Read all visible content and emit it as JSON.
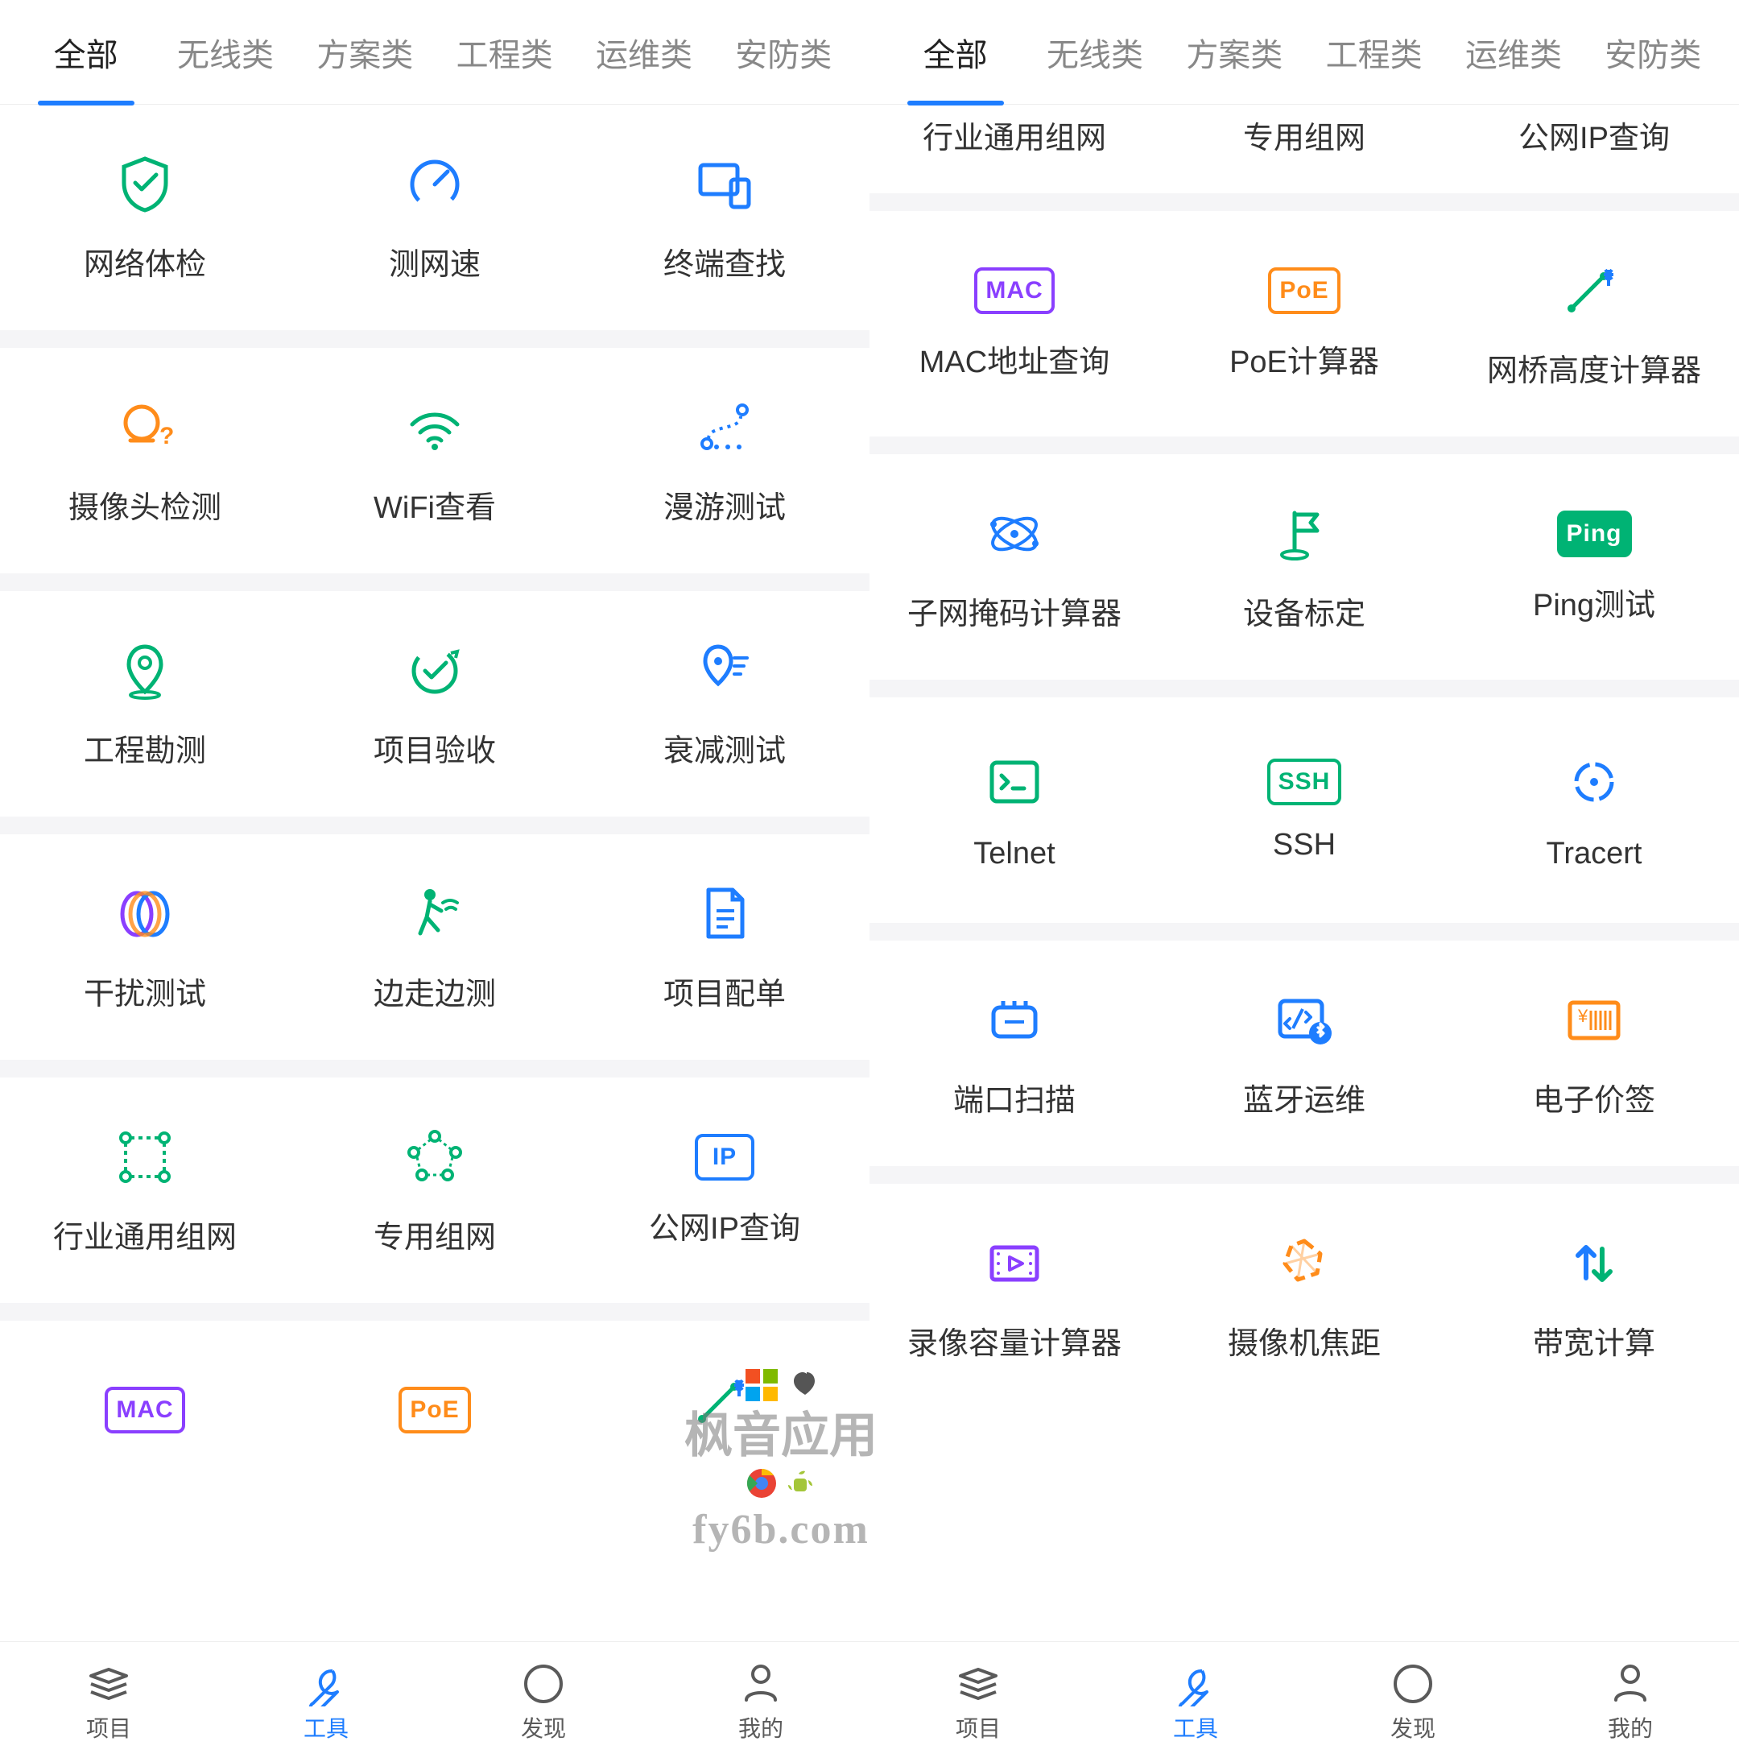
{
  "tabs": [
    "全部",
    "无线类",
    "方案类",
    "工程类",
    "运维类",
    "安防类"
  ],
  "activeTab": "全部",
  "screenLeft": {
    "groups": [
      {
        "tools": [
          {
            "id": "net-check",
            "label": "网络体检",
            "color": "#00b374",
            "svg": "shield-check"
          },
          {
            "id": "speed-test",
            "label": "测网速",
            "color": "#1e7dff",
            "svg": "gauge"
          },
          {
            "id": "terminal-find",
            "label": "终端查找",
            "color": "#1e7dff",
            "svg": "devices"
          }
        ]
      },
      {
        "tools": [
          {
            "id": "camera-detect",
            "label": "摄像头检测",
            "color": "#ff8c1a",
            "svg": "camera-q"
          },
          {
            "id": "wifi-view",
            "label": "WiFi查看",
            "color": "#00b374",
            "svg": "wifi"
          },
          {
            "id": "roam-test",
            "label": "漫游测试",
            "color": "#1e7dff",
            "svg": "route"
          }
        ]
      },
      {
        "tools": [
          {
            "id": "survey",
            "label": "工程勘测",
            "color": "#00b374",
            "svg": "pin-person"
          },
          {
            "id": "accept",
            "label": "项目验收",
            "color": "#00b374",
            "svg": "check-circle-arrow"
          },
          {
            "id": "atten",
            "label": "衰减测试",
            "color": "#1e7dff",
            "svg": "pin-waves"
          }
        ]
      },
      {
        "tools": [
          {
            "id": "interf",
            "label": "干扰测试",
            "color": "#8a3fff",
            "svg": "interf"
          },
          {
            "id": "walk-test",
            "label": "边走边测",
            "color": "#00b374",
            "svg": "walk-wifi"
          },
          {
            "id": "bom",
            "label": "项目配单",
            "color": "#1e7dff",
            "svg": "doc"
          }
        ]
      },
      {
        "tools": [
          {
            "id": "topo",
            "label": "行业通用组网",
            "color": "#00b374",
            "svg": "topo-square"
          },
          {
            "id": "topo2",
            "label": "专用组网",
            "color": "#00b374",
            "svg": "topo-ring"
          },
          {
            "id": "ip",
            "label": "公网IP查询",
            "badge": "IP",
            "badgeClass": "ip"
          }
        ]
      }
    ],
    "partial": [
      {
        "id": "mac",
        "badge": "MAC",
        "badgeClass": "mac"
      },
      {
        "id": "poe",
        "badge": "PoE",
        "badgeClass": "poe"
      },
      {
        "id": "bridge",
        "color": "#00b374",
        "svg": "bridge"
      }
    ]
  },
  "screenRight": {
    "topLabels": [
      "行业通用组网",
      "专用组网",
      "公网IP查询"
    ],
    "groups": [
      {
        "tools": [
          {
            "id": "mac",
            "label": "MAC地址查询",
            "badge": "MAC",
            "badgeClass": "mac"
          },
          {
            "id": "poe",
            "label": "PoE计算器",
            "badge": "PoE",
            "badgeClass": "poe"
          },
          {
            "id": "bridge",
            "label": "网桥高度计算器",
            "color": "#00b374",
            "svg": "bridge"
          }
        ]
      },
      {
        "tools": [
          {
            "id": "subnet",
            "label": "子网掩码计算器",
            "color": "#1e7dff",
            "svg": "atom"
          },
          {
            "id": "calib",
            "label": "设备标定",
            "color": "#00b374",
            "svg": "flag"
          },
          {
            "id": "ping",
            "label": "Ping测试",
            "badge": "Ping",
            "badgeClass": "ping"
          }
        ]
      },
      {
        "tools": [
          {
            "id": "telnet",
            "label": "Telnet",
            "color": "#00b374",
            "svg": "terminal"
          },
          {
            "id": "ssh",
            "label": "SSH",
            "badge": "SSH",
            "badgeClass": "ssh"
          },
          {
            "id": "tracert",
            "label": "Tracert",
            "color": "#1e7dff",
            "svg": "target"
          }
        ]
      },
      {
        "tools": [
          {
            "id": "portscan",
            "label": "端口扫描",
            "color": "#1e7dff",
            "svg": "port"
          },
          {
            "id": "bluetooth",
            "label": "蓝牙运维",
            "color": "#1e7dff",
            "svg": "code-bt"
          },
          {
            "id": "eprice",
            "label": "电子价签",
            "color": "#ff8c1a",
            "svg": "barcode"
          }
        ]
      },
      {
        "tools": [
          {
            "id": "record",
            "label": "录像容量计算器",
            "color": "#8a3fff",
            "svg": "film"
          },
          {
            "id": "focal",
            "label": "摄像机焦距",
            "color": "#ff8c1a",
            "svg": "aperture"
          },
          {
            "id": "bandwidth",
            "label": "带宽计算",
            "color": "#00b374",
            "svg": "updown"
          }
        ]
      }
    ]
  },
  "bottomNav": [
    {
      "id": "project",
      "label": "项目",
      "svg": "layers"
    },
    {
      "id": "tools",
      "label": "工具",
      "svg": "wrench",
      "active": true
    },
    {
      "id": "discover",
      "label": "发现",
      "svg": "compass"
    },
    {
      "id": "mine",
      "label": "我的",
      "svg": "person"
    }
  ],
  "watermark": {
    "line1": "枫音应用",
    "line2": "fy6b.com"
  }
}
